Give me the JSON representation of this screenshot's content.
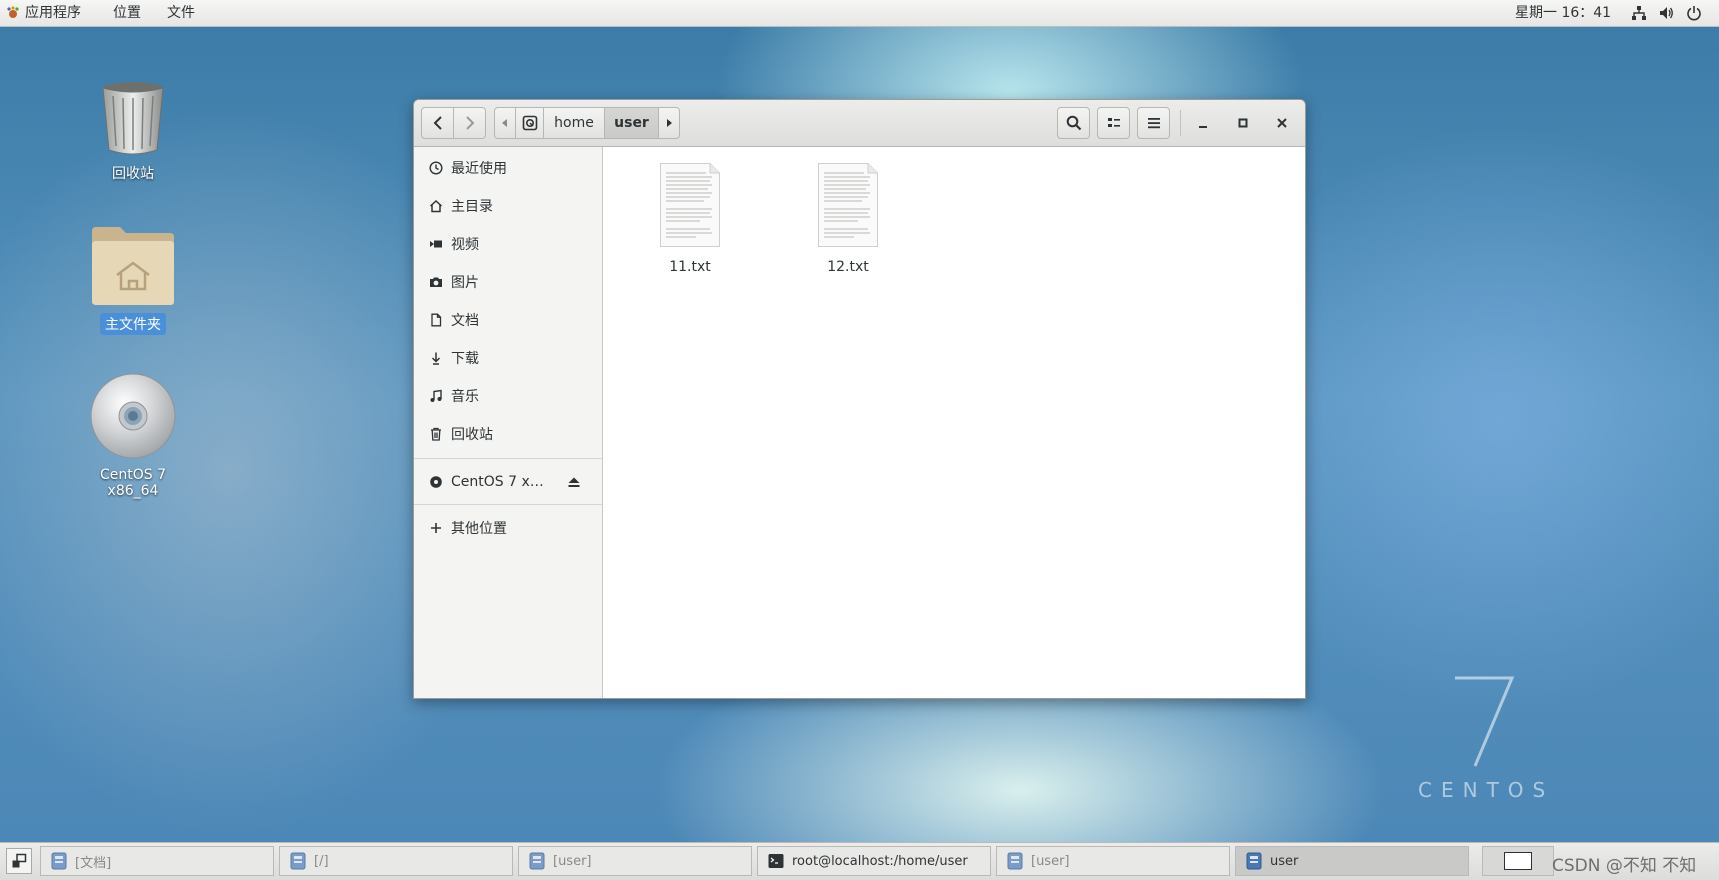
{
  "topbar": {
    "apps_label": "应用程序",
    "places_label": "位置",
    "files_label": "文件",
    "clock": "星期一 16：41",
    "tray_icons": [
      "network-icon",
      "volume-icon",
      "power-icon"
    ]
  },
  "desktop": {
    "icons": [
      {
        "label": "回收站",
        "icon": "trash-icon"
      },
      {
        "label": "主文件夹",
        "icon": "home-folder-icon",
        "selected": true
      },
      {
        "label": "CentOS 7 x86_64",
        "icon": "disc-icon"
      }
    ],
    "watermark": {
      "number": "7",
      "word": "CENTOS"
    }
  },
  "window": {
    "breadcrumb": [
      "home",
      "user"
    ],
    "current_folder": "user",
    "sidebar": {
      "places": [
        {
          "label": "最近使用",
          "icon": "recent-icon"
        },
        {
          "label": "主目录",
          "icon": "home-icon"
        },
        {
          "label": "视频",
          "icon": "video-icon"
        },
        {
          "label": "图片",
          "icon": "camera-icon"
        },
        {
          "label": "文档",
          "icon": "document-icon"
        },
        {
          "label": "下载",
          "icon": "download-icon"
        },
        {
          "label": "音乐",
          "icon": "music-icon"
        },
        {
          "label": "回收站",
          "icon": "trash-icon"
        }
      ],
      "devices": [
        {
          "label": "CentOS 7 x…",
          "icon": "disc-icon",
          "eject": true
        }
      ],
      "other": {
        "label": "其他位置",
        "icon": "plus-icon"
      }
    },
    "files": [
      {
        "name": "11.txt",
        "type": "text"
      },
      {
        "name": "12.txt",
        "type": "text"
      }
    ]
  },
  "taskbar": {
    "tasks": [
      {
        "label": "[文档]",
        "icon": "file-manager-icon",
        "state": "minimized"
      },
      {
        "label": "[/]",
        "icon": "file-manager-icon",
        "state": "minimized"
      },
      {
        "label": "[user]",
        "icon": "file-manager-icon",
        "state": "minimized"
      },
      {
        "label": "root@localhost:/home/user",
        "icon": "terminal-icon",
        "state": "normal"
      },
      {
        "label": "[user]",
        "icon": "file-manager-icon",
        "state": "minimized"
      },
      {
        "label": "user",
        "icon": "file-manager-icon",
        "state": "active"
      }
    ],
    "watermark_text": "CSDN @不知 不知"
  }
}
